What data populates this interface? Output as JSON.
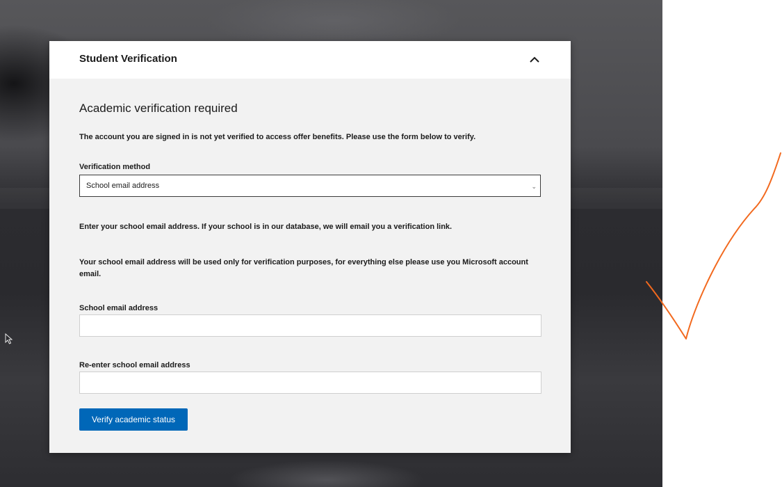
{
  "panel": {
    "title": "Student Verification"
  },
  "form": {
    "heading": "Academic verification required",
    "notice": "The account you are signed in is not yet verified to access offer benefits. Please use the form below to verify.",
    "method_label": "Verification method",
    "method_selected": "School email address",
    "instructions": "Enter your school email address. If your school is in our database, we will email you a verification link.",
    "privacy_note": "Your school email address will be used only for verification purposes, for everything else please use you Microsoft account email.",
    "email_label": "School email address",
    "email_value": "",
    "reenter_label": "Re-enter school email address",
    "reenter_value": "",
    "submit_label": "Verify academic status"
  },
  "colors": {
    "accent": "#0067b8",
    "annotation": "#f2691e"
  },
  "icons": {
    "collapse": "chevron-up-icon",
    "dropdown": "chevron-down-icon",
    "cursor": "mouse-pointer-icon",
    "annotation": "checkmark-icon"
  }
}
